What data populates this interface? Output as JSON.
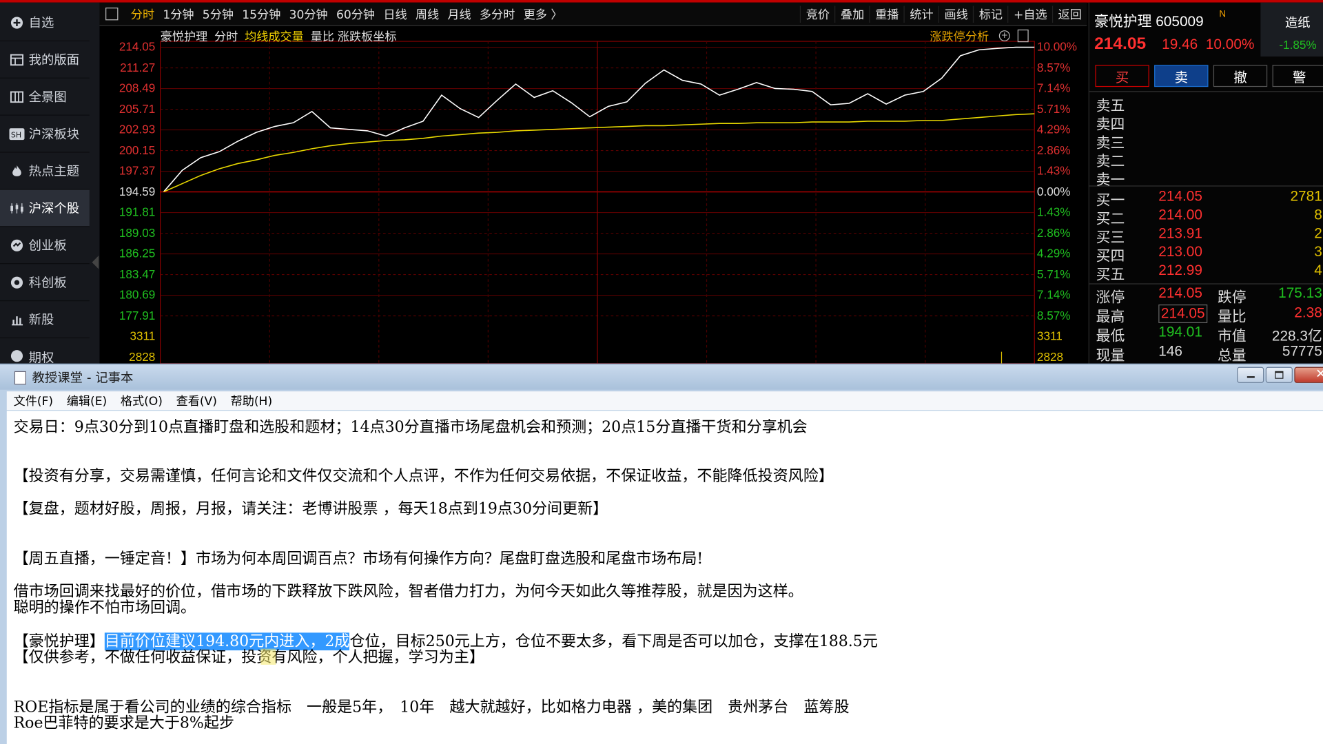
{
  "sidebar": {
    "items": [
      {
        "label": "自选",
        "icon": "plus-circle-icon"
      },
      {
        "label": "我的版面",
        "icon": "layout-icon"
      },
      {
        "label": "全景图",
        "icon": "grid-icon"
      },
      {
        "label": "沪深板块",
        "icon": "sh-icon"
      },
      {
        "label": "热点主题",
        "icon": "flame-icon"
      },
      {
        "label": "沪深个股",
        "icon": "candlestick-icon"
      },
      {
        "label": "创业板",
        "icon": "gem-icon"
      },
      {
        "label": "科创板",
        "icon": "star-circle-icon"
      },
      {
        "label": "新股",
        "icon": "bar-chart-icon"
      },
      {
        "label": "期权",
        "icon": "options-icon"
      }
    ]
  },
  "toolbar": {
    "periods": [
      "分时",
      "1分钟",
      "5分钟",
      "15分钟",
      "30分钟",
      "60分钟",
      "日线",
      "周线",
      "月线",
      "多分时",
      "更多 〉"
    ],
    "tools": [
      "竞价",
      "叠加",
      "重播",
      "统计",
      "画线",
      "标记",
      "+自选",
      "返回"
    ]
  },
  "chart": {
    "stock_name": "豪悦护理",
    "mode": "分时",
    "avg_line_label": "均线",
    "volume_label": "成交量",
    "ratio_label": "量比",
    "limit_axis_label": "涨跌板坐标",
    "analysis_label": "涨跌停分析",
    "left_labels": [
      "214.05",
      "211.27",
      "208.49",
      "205.71",
      "202.93",
      "200.15",
      "197.37",
      "194.59",
      "191.81",
      "189.03",
      "186.25",
      "183.47",
      "180.69",
      "177.91",
      "3311",
      "2828"
    ],
    "right_labels": [
      "10.00%",
      "8.57%",
      "7.14%",
      "5.71%",
      "4.29%",
      "2.86%",
      "1.43%",
      "0.00%",
      "1.43%",
      "2.86%",
      "4.29%",
      "5.71%",
      "7.14%",
      "8.57%",
      "3311",
      "2828"
    ]
  },
  "chart_data": {
    "type": "line",
    "ylim": [
      177.91,
      214.05
    ],
    "prev_close": 194.59,
    "series": [
      {
        "values": [
          194.6,
          197.5,
          199.2,
          200.0,
          201.4,
          202.6,
          203.4,
          203.9,
          205.4,
          203.2,
          203.0,
          202.8,
          202.1,
          203.2,
          204.1,
          207.6,
          205.8,
          204.6,
          206.9,
          209.1,
          207.3,
          208.2,
          206.6,
          204.7,
          206.1,
          206.7,
          209.2,
          211.0,
          209.6,
          209.1,
          207.6,
          208.4,
          209.3,
          208.5,
          208.4,
          208.1,
          206.3,
          206.5,
          207.8,
          206.4,
          207.6,
          208.1,
          209.9,
          212.9,
          213.7,
          213.9,
          214.05,
          214.05
        ]
      },
      {
        "values": [
          194.6,
          195.7,
          196.8,
          197.7,
          198.4,
          198.9,
          199.5,
          199.9,
          200.4,
          200.8,
          201.1,
          201.3,
          201.5,
          201.6,
          201.8,
          202.1,
          202.3,
          202.5,
          202.6,
          202.8,
          202.9,
          203.0,
          203.1,
          203.2,
          203.3,
          203.4,
          203.5,
          203.5,
          203.6,
          203.7,
          203.8,
          203.8,
          203.9,
          203.9,
          203.9,
          204.0,
          204.0,
          204.0,
          204.1,
          204.1,
          204.1,
          204.2,
          204.2,
          204.4,
          204.6,
          204.8,
          205.0,
          205.1
        ]
      }
    ]
  },
  "quote": {
    "name_code": "豪悦护理 605009",
    "badge": "N",
    "price": "214.05",
    "change": "19.46",
    "pct": "10.00%",
    "side_label": "造纸",
    "side_pct": "-1.85%",
    "buttons": [
      "买",
      "卖",
      "撤",
      "警"
    ],
    "sell_labels": [
      "卖五",
      "卖四",
      "卖三",
      "卖二",
      "卖一"
    ],
    "buys": [
      {
        "label": "买一",
        "price": "214.05",
        "vol": "2781"
      },
      {
        "label": "买二",
        "price": "214.00",
        "vol": "8"
      },
      {
        "label": "买三",
        "price": "213.91",
        "vol": "2"
      },
      {
        "label": "买四",
        "price": "213.00",
        "vol": "3"
      },
      {
        "label": "买五",
        "price": "212.99",
        "vol": "4"
      }
    ],
    "stats": [
      {
        "k1": "涨停",
        "v1": "214.05",
        "k2": "跌停",
        "v2": "175.13"
      },
      {
        "k1": "最高",
        "v1": "214.05",
        "k2": "量比",
        "v2": "2.38"
      },
      {
        "k1": "最低",
        "v1": "194.01",
        "k2": "市值",
        "v2": "228.3亿"
      },
      {
        "k1": "现量",
        "v1": "146",
        "k2": "总量",
        "v2": "57775"
      }
    ]
  },
  "notepad": {
    "title": "教授课堂 - 记事本",
    "menu": [
      "文件(F)",
      "编辑(E)",
      "格式(O)",
      "查看(V)",
      "帮助(H)"
    ],
    "line1": "交易日：9点30分到10点直播盯盘和选股和题材；14点30分直播市场尾盘机会和预测；20点15分直播干货和分享机会",
    "line2": "【投资有分享，交易需谨慎，任何言论和文件仅交流和个人点评，不作为任何交易依据，不保证收益，不能降低投资风险】",
    "line3": "【复盘，题材好股，周报，月报，请关注：老博讲股票 ，每天18点到19点30分间更新】",
    "line4": "【周五直播，一锤定音！】市场为何本周回调百点？市场有何操作方向？尾盘盯盘选股和尾盘市场布局!",
    "line5": "借市场回调来找最好的价位，借市场的下跌释放下跌风险，智者借力打力，为何今天如此久等推荐股，就是因为这样。",
    "line6": "聪明的操作不怕市场回调。",
    "line7_pre": "【豪悦护理】",
    "line7_sel": "目前价位建议194.80元内进入，2成",
    "line7_post": "仓位，目标250元上方，仓位不要太多，看下周是否可以加仓，支撑在188.5元",
    "line8": "【仅供参考，不做任何收益保证，投资有风险，个人把握，学习为主】",
    "line9": "ROE指标是属于看公司的业绩的综合指标　一般是5年，　10年　越大就越好，比如格力电器 ，美的集团　贵州茅台　蓝筹股",
    "line10": "Roe巴菲特的要求是大于8%起步"
  }
}
